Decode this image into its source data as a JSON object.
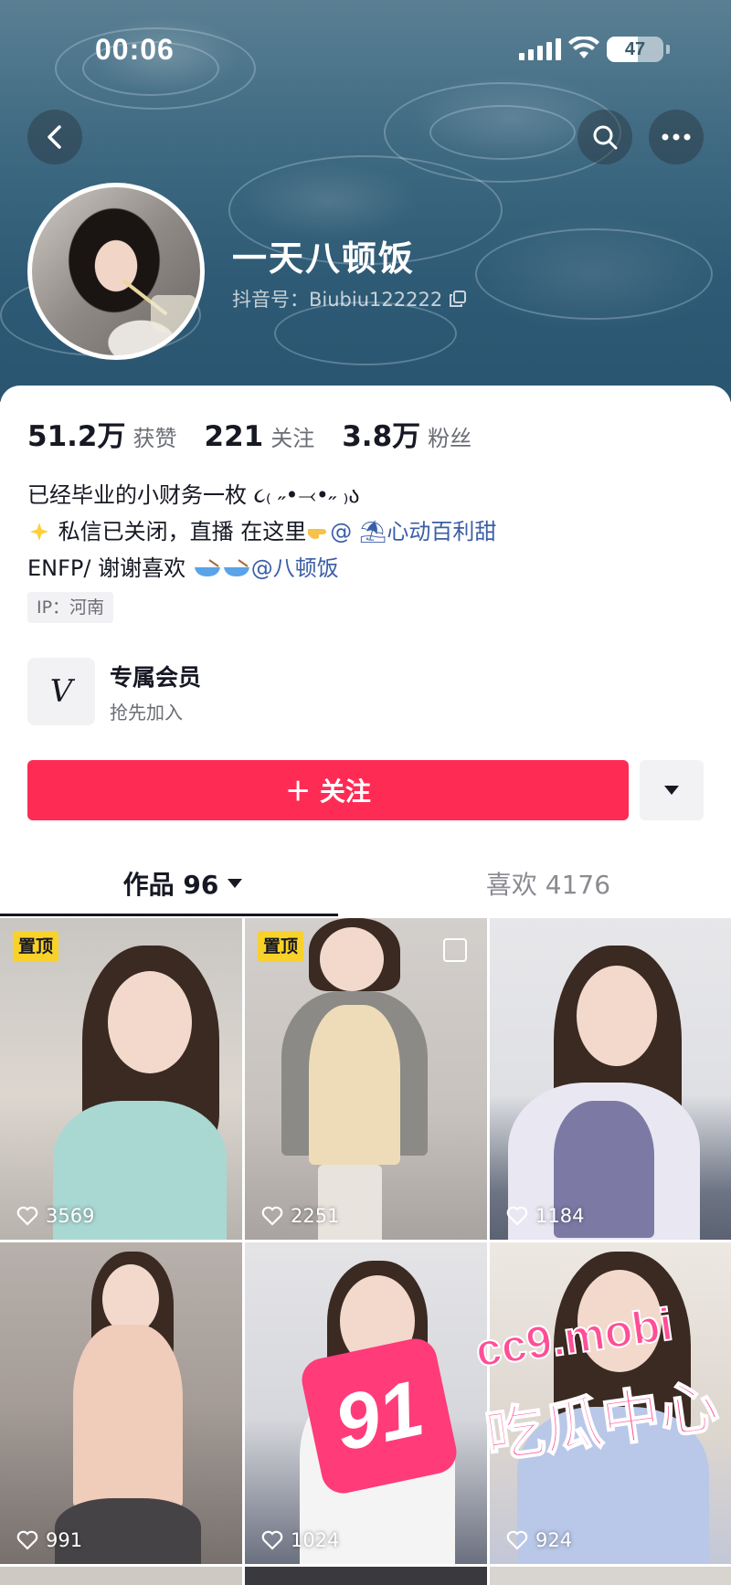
{
  "status_bar": {
    "time": "00:06",
    "battery": "47"
  },
  "profile": {
    "nickname": "一天八顿饭",
    "douyin_id": "抖音号：Biubiu122222"
  },
  "stats": [
    {
      "value": "51.2万",
      "label": "获赞"
    },
    {
      "value": "221",
      "label": "关注"
    },
    {
      "value": "3.8万",
      "label": "粉丝"
    }
  ],
  "bio": {
    "line1": "已经毕业的小财务一枚 ૮₍ ˶•⤙•˶ ₎ა",
    "line2_prefix": "私信已关闭，直播 在这里",
    "line2_link": "@ ⛱心动百利甜",
    "line3_prefix": "ENFP/  谢谢喜欢 ",
    "line3_link": "@八顿饭"
  },
  "ip_tag": "IP：河南",
  "member": {
    "title": "专属会员",
    "subtitle": "抢先加入",
    "icon": "V"
  },
  "follow_button": "＋ 关注",
  "tabs": {
    "works": "作品 96",
    "likes": "喜欢 4176"
  },
  "videos": [
    {
      "likes": "3569",
      "pinned": "置顶"
    },
    {
      "likes": "2251",
      "pinned": "置顶"
    },
    {
      "likes": "1184"
    },
    {
      "likes": "991"
    },
    {
      "likes": "1024"
    },
    {
      "likes": "924"
    }
  ],
  "watermark": {
    "badge": "91",
    "url": "cc9.mobi",
    "text": "吃瓜中心"
  },
  "colors": {
    "accent": "#fe2c55",
    "link": "#3b5ea6",
    "pin": "#f8d22a"
  }
}
